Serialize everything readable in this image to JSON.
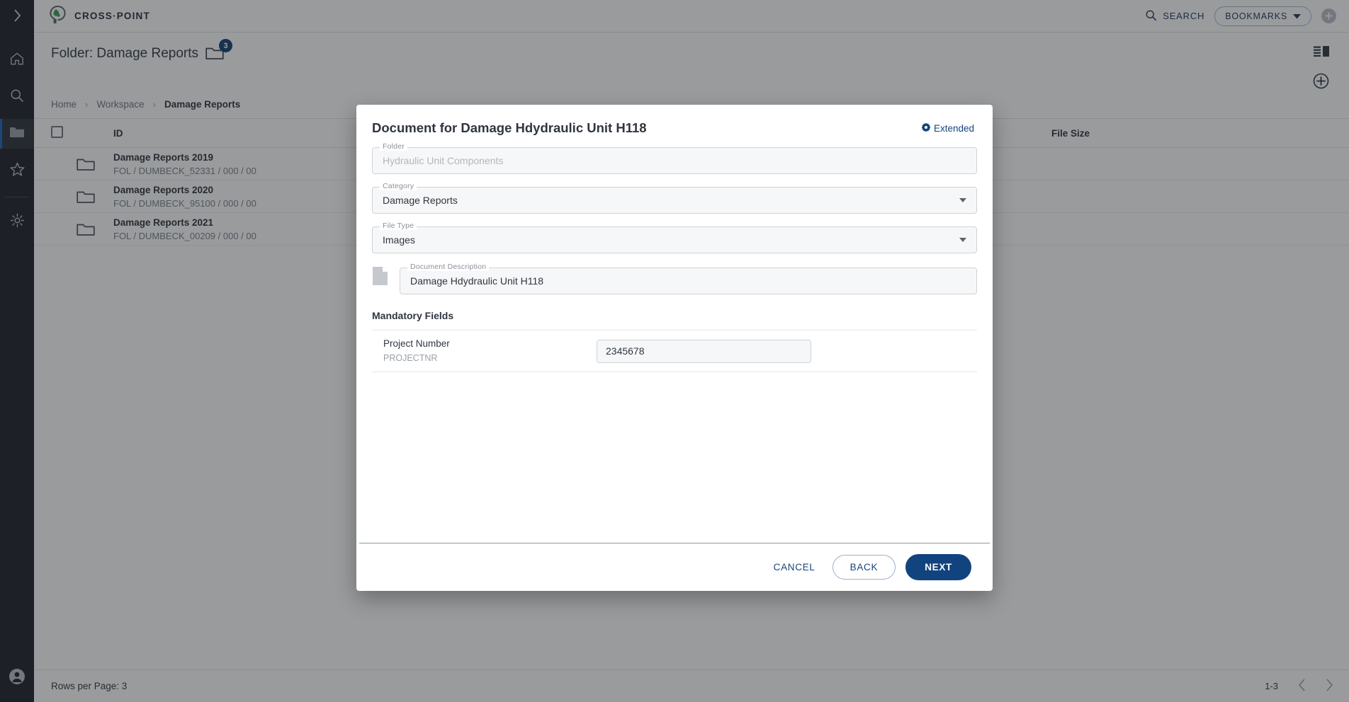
{
  "brand": {
    "name": "CROSS·POINT",
    "logo_icon": "crosspoint-logo-icon"
  },
  "topbar": {
    "search_label": "SEARCH",
    "search_icon": "search-icon",
    "bookmarks_label": "BOOKMARKS",
    "bookmarks_caret_icon": "chevron-down-icon",
    "add_icon": "plus-circle-icon"
  },
  "sidebar": {
    "expand_icon": "chevron-right-icon",
    "items": [
      {
        "name": "home",
        "icon": "home-icon",
        "active": false
      },
      {
        "name": "search",
        "icon": "search-icon",
        "active": false
      },
      {
        "name": "folders",
        "icon": "folder-icon",
        "active": true
      },
      {
        "name": "favorites",
        "icon": "star-icon",
        "active": false
      },
      {
        "name": "settings",
        "icon": "gear-icon",
        "active": false
      }
    ],
    "user_icon": "user-avatar-icon"
  },
  "page": {
    "title": "Folder: Damage Reports",
    "folder_icon": "folder-icon",
    "badge_count": "3",
    "list_view_icon": "list-view-icon",
    "add_icon": "plus-circle-icon",
    "breadcrumb": [
      {
        "label": "Home",
        "active": false
      },
      {
        "label": "Workspace",
        "active": false
      },
      {
        "label": "Damage Reports",
        "active": true
      }
    ],
    "breadcrumb_separator": "›"
  },
  "table": {
    "columns": {
      "id": "ID",
      "file_size": "File Size"
    },
    "select_all_checkbox": false,
    "rows": [
      {
        "icon": "folder-icon",
        "name": "Damage Reports 2019",
        "id": "FOL / DUMBECK_52331 / 000 / 00",
        "file_size": ""
      },
      {
        "icon": "folder-icon",
        "name": "Damage Reports 2020",
        "id": "FOL / DUMBECK_95100 / 000 / 00",
        "file_size": ""
      },
      {
        "icon": "folder-icon",
        "name": "Damage Reports 2021",
        "id": "FOL / DUMBECK_00209 / 000 / 00",
        "file_size": ""
      }
    ]
  },
  "footer": {
    "rows_per_page": "Rows per Page: 3",
    "range": "1-3",
    "prev_icon": "chevron-left-icon",
    "next_icon": "chevron-right-icon"
  },
  "dialog": {
    "title": "Document for Damage Hdydraulic Unit H118",
    "extended_label": "Extended",
    "extended_icon": "gear-icon",
    "fields": {
      "folder": {
        "label": "Folder",
        "value": "",
        "placeholder": "Hydraulic Unit Components"
      },
      "category": {
        "label": "Category",
        "value": "Damage Reports",
        "caret_icon": "caret-down-icon"
      },
      "file_type": {
        "label": "File Type",
        "value": "Images",
        "caret_icon": "caret-down-icon"
      },
      "document_description": {
        "label": "Document Description",
        "value": "Damage Hdydraulic Unit H118",
        "icon": "document-file-icon"
      }
    },
    "mandatory": {
      "heading": "Mandatory Fields",
      "rows": [
        {
          "label": "Project Number",
          "code": "PROJECTNR",
          "value": "2345678"
        }
      ]
    },
    "buttons": {
      "cancel": "CANCEL",
      "back": "BACK",
      "next": "NEXT"
    }
  },
  "colors": {
    "brand_dark": "#11447e",
    "accent_link": "#15447e",
    "badge": "#0d3b73",
    "rail_bg": "#1b1f26",
    "rail_active_bar": "#1565c0",
    "logo_green": "#3a9b4e"
  }
}
